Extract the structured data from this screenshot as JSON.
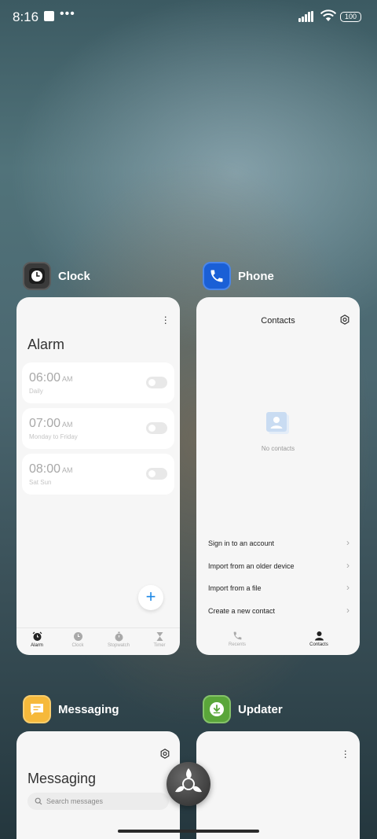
{
  "status_bar": {
    "time": "8:16",
    "dots": "•••",
    "battery": "100"
  },
  "apps": {
    "clock": {
      "name": "Clock",
      "icon": "clock-icon",
      "card": {
        "title": "Alarm",
        "alarms": [
          {
            "time": "06:00",
            "ampm": "AM",
            "repeat": "Daily",
            "enabled": false
          },
          {
            "time": "07:00",
            "ampm": "AM",
            "repeat": "Monday to Friday",
            "enabled": false
          },
          {
            "time": "08:00",
            "ampm": "AM",
            "repeat": "Sat Sun",
            "enabled": false
          }
        ],
        "add_label": "+",
        "nav": [
          {
            "label": "Alarm",
            "icon": "alarm-icon",
            "active": true
          },
          {
            "label": "Clock",
            "icon": "clock-face-icon",
            "active": false
          },
          {
            "label": "Stopwatch",
            "icon": "stopwatch-icon",
            "active": false
          },
          {
            "label": "Timer",
            "icon": "hourglass-icon",
            "active": false
          }
        ]
      }
    },
    "phone": {
      "name": "Phone",
      "icon": "phone-icon",
      "card": {
        "title": "Contacts",
        "empty_text": "No contacts",
        "options": [
          "Sign in to an account",
          "Import from an older device",
          "Import from a file",
          "Create a new contact"
        ],
        "nav": [
          {
            "label": "Recents",
            "icon": "phone-handset-icon",
            "active": false
          },
          {
            "label": "Contacts",
            "icon": "person-icon",
            "active": true
          }
        ]
      }
    },
    "messaging": {
      "name": "Messaging",
      "icon": "message-icon",
      "card": {
        "title": "Messaging",
        "search_placeholder": "Search messages"
      }
    },
    "updater": {
      "name": "Updater",
      "icon": "download-icon"
    }
  },
  "colors": {
    "clock_icon_bg": "#3a3a3a",
    "phone_icon_bg": "#1a5fd6",
    "messaging_icon_bg": "#f6b93b",
    "updater_icon_bg": "#5aa63a",
    "accent_blue": "#1e88e5"
  }
}
